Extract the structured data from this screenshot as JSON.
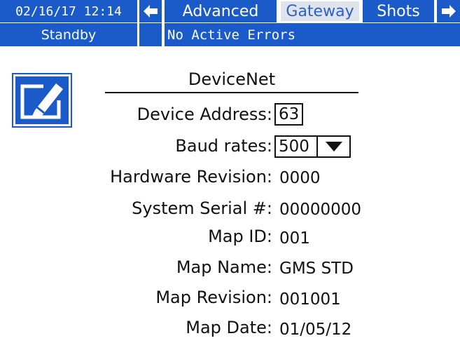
{
  "topbar": {
    "datetime": "02/16/17 12:14",
    "nav_left_icon": "arrow-left-icon",
    "tabs": [
      {
        "label": "Advanced",
        "active": false
      },
      {
        "label": "Gateway",
        "active": true
      },
      {
        "label": "Shots",
        "active": false
      }
    ],
    "nav_right_icon": "arrow-right-icon"
  },
  "statusbar": {
    "mode": "Standby",
    "errors": "No Active Errors"
  },
  "edit_button": {
    "icon": "edit-pencil-icon"
  },
  "section": {
    "title": "DeviceNet"
  },
  "fields": {
    "device_address": {
      "label": "Device Address:",
      "value": "63"
    },
    "baud_rates": {
      "label": "Baud rates:",
      "value": "500"
    },
    "hardware_revision": {
      "label": "Hardware Revision:",
      "value": "0000"
    },
    "system_serial": {
      "label": "System Serial #:",
      "value": "00000000"
    },
    "map_id": {
      "label": "Map ID:",
      "value": "001"
    },
    "map_name": {
      "label": "Map Name:",
      "value": "GMS STD"
    },
    "map_revision": {
      "label": "Map Revision:",
      "value": "001001"
    },
    "map_date": {
      "label": "Map Date:",
      "value": "01/05/12"
    }
  },
  "colors": {
    "accent": "#1a5bc9",
    "active_tab_bg": "#dfe3ec",
    "active_tab_text": "#2a62c9",
    "text": "#111111"
  }
}
